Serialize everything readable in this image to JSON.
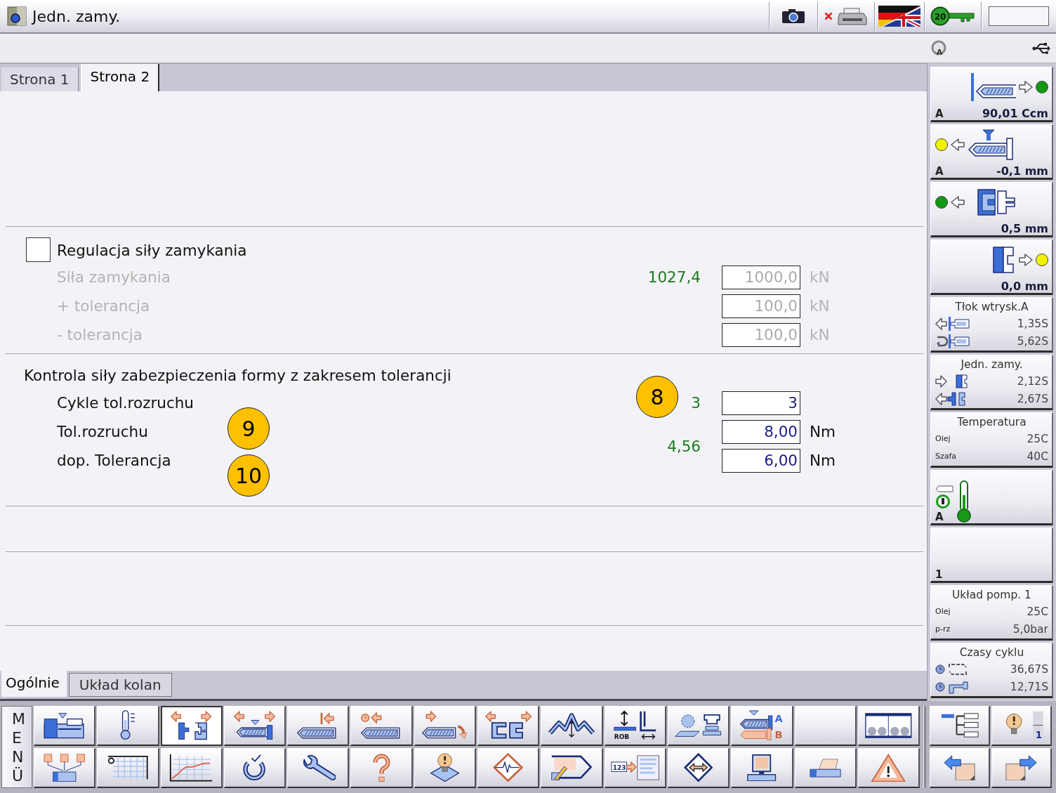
{
  "window": {
    "title": "Jedn. zamy."
  },
  "status_area": {
    "printer_offline": true,
    "key_label": "20"
  },
  "subbar": {
    "mode_label": "A"
  },
  "tabs": [
    {
      "label": "Strona 1",
      "selected": false
    },
    {
      "label": "Strona 2",
      "selected": true
    }
  ],
  "form": {
    "clamp_force": {
      "label": "Regulacja siły zamykania",
      "checked": false,
      "rows": [
        {
          "label": "Siła zamykania",
          "actual": "1027,4",
          "value": "1000,0",
          "unit": "kN",
          "disabled": true
        },
        {
          "label": "+ tolerancja",
          "value": "100,0",
          "unit": "kN",
          "disabled": true
        },
        {
          "label": "- tolerancja",
          "value": "100,0",
          "unit": "kN",
          "disabled": true
        }
      ]
    },
    "mold_protection": {
      "title": "Kontrola siły zabezpieczenia formy z zakresem tolerancji",
      "rows": [
        {
          "label": "Cykle tol.rozruchu",
          "actual": "3",
          "value": "3",
          "disabled": false
        },
        {
          "label": "Tol.rozruchu",
          "value": "8,00",
          "unit": "Nm",
          "disabled": false
        },
        {
          "label": "dop. Tolerancja",
          "value": "6,00",
          "unit": "Nm",
          "disabled": false
        }
      ],
      "torque_actual": "4,56"
    },
    "callouts": [
      {
        "label": "8"
      },
      {
        "label": "9"
      },
      {
        "label": "10"
      }
    ]
  },
  "bottom_tabs": [
    {
      "label": "Ogólnie",
      "selected": true
    },
    {
      "label": "Układ kolan",
      "selected": false
    }
  ],
  "side_panel": {
    "cards": [
      {
        "kind": "status",
        "corner": "A",
        "value": "90,01 Ccm",
        "color": "#119911"
      },
      {
        "kind": "status",
        "corner": "A",
        "value": "-0,1 mm",
        "color": "#f2f200"
      },
      {
        "kind": "status",
        "value": "0,5 mm",
        "color": "#119911"
      },
      {
        "kind": "status",
        "value": "0,0 mm",
        "color": "#f2f200"
      },
      {
        "kind": "times",
        "title": "Tłok wtrysk.A",
        "rows": [
          {
            "value": "1,35S"
          },
          {
            "value": "5,62S"
          }
        ]
      },
      {
        "kind": "times",
        "title": "Jedn. zamy.",
        "rows": [
          {
            "value": "2,12S"
          },
          {
            "value": "2,67S"
          }
        ]
      },
      {
        "kind": "readings",
        "title": "Temperatura",
        "rows": [
          {
            "label": "Olej",
            "value": "25C"
          },
          {
            "label": "Szafa",
            "value": "40C"
          }
        ]
      },
      {
        "kind": "status",
        "corner": "A"
      },
      {
        "kind": "status",
        "corner": "1"
      },
      {
        "kind": "readings",
        "title": "Układ pomp. 1",
        "rows": [
          {
            "label": "Olej",
            "value": "25C"
          },
          {
            "label": "p-rz",
            "value": "5,0bar"
          }
        ]
      },
      {
        "kind": "times",
        "title": "Czasy cyklu",
        "rows": [
          {
            "value": "36,67S"
          },
          {
            "value": "12,71S"
          }
        ]
      }
    ]
  },
  "toolbar": {
    "menu_label": "MENÜ",
    "rows": [
      [
        {
          "selected": false
        },
        {
          "selected": false
        },
        {
          "selected": true
        },
        {
          "selected": false
        },
        {
          "selected": false
        },
        {
          "selected": false
        },
        {
          "selected": false
        },
        {
          "selected": false
        },
        {
          "selected": false
        },
        {
          "selected": false,
          "caption": "ROB"
        },
        {
          "selected": false
        },
        {
          "selected": false,
          "captions": [
            "A",
            "B"
          ]
        },
        {
          "selected": false
        },
        {
          "selected": false
        }
      ],
      [
        {
          "selected": false
        },
        {
          "selected": false
        },
        {
          "selected": false
        },
        {
          "selected": false
        },
        {
          "selected": false
        },
        {
          "selected": false
        },
        {
          "selected": false
        },
        {
          "selected": false
        },
        {
          "selected": false
        },
        {
          "selected": false,
          "caption": "123"
        },
        {
          "selected": false
        },
        {
          "selected": false
        },
        {
          "selected": false
        },
        {
          "selected": false
        }
      ]
    ],
    "side_buttons": [
      [
        {
          "selected": false
        },
        {
          "selected": false,
          "caption": "1"
        }
      ],
      [
        {
          "selected": false
        },
        {
          "selected": false
        }
      ]
    ]
  }
}
